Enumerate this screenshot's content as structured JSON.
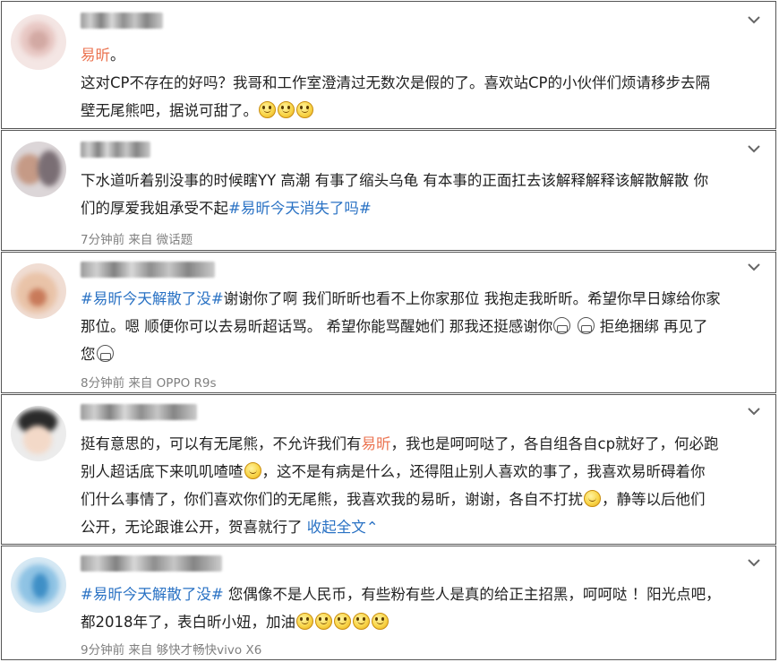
{
  "comments": [
    {
      "line1_link": "易昕",
      "line1_rest": "。",
      "line2": "这对CP不存在的好吗？我哥和工作室澄清过无数次是假的了。喜欢站CP的小伙伴们烦请移步去隔",
      "line3": "壁无尾熊吧，据说可甜了。",
      "emoji": "smile-emoji"
    },
    {
      "line1": "下水道听着别没事的时候瞎YY 高潮 有事了缩头乌龟 有本事的正面扛去该解释解释该解散解散 你",
      "line2_pre": "们的厚爱我姐承受不起",
      "line2_topic": "#易昕今天消失了吗#",
      "time": "7分钟前 来自 微话题"
    },
    {
      "topic": "#易昕今天解散了没#",
      "line1_rest": "谢谢你了啊 我们昕昕也看不上你家那位 我抱走我昕昕。希望你早日嫁给你家",
      "line2": "那位。嗯 顺便你可以去易昕超话骂。 希望你能骂醒她们 那我还挺感谢你",
      "line2_end": " 拒绝捆绑 再见了",
      "line3": "您",
      "time": "8分钟前 来自 OPPO R9s"
    },
    {
      "line1_pre": "挺有意思的，可以有无尾熊，不允许我们有",
      "line1_link": "易昕",
      "line1_post": "，我也是呵呵哒了，各自组各自cp就好了，何必跑",
      "line2_pre": "别人超话底下来叽叽喳喳",
      "line2_post": "，这不是有病是什么，还得阻止别人喜欢的事了，我喜欢易昕碍着你",
      "line3_pre": "们什么事情了，你们喜欢你们的无尾熊，我喜欢我的易昕，谢谢，各自不打扰",
      "line3_post": "，静等以后他们",
      "line4": "公开，无论跟谁公开，贺喜就行了 ",
      "collapse": "收起全文",
      "collapse_arrow": "⌃"
    },
    {
      "topic": "#易昕今天解散了没#",
      "line1_rest": " 您偶像不是人民币，有些粉有些人是真的给正主招黑，呵呵哒 ！阳光点吧，",
      "line2": "都2018年了，表白昕小妞，加油",
      "time": "9分钟前 来自 够快才畅快vivo X6"
    }
  ],
  "colors": {
    "link": "#eb7350",
    "topic": "#2a72c4",
    "meta": "#808080"
  },
  "icons": [
    "chevron-down-icon",
    "smile-emoji",
    "grin-emoji",
    "fence-emoji"
  ]
}
